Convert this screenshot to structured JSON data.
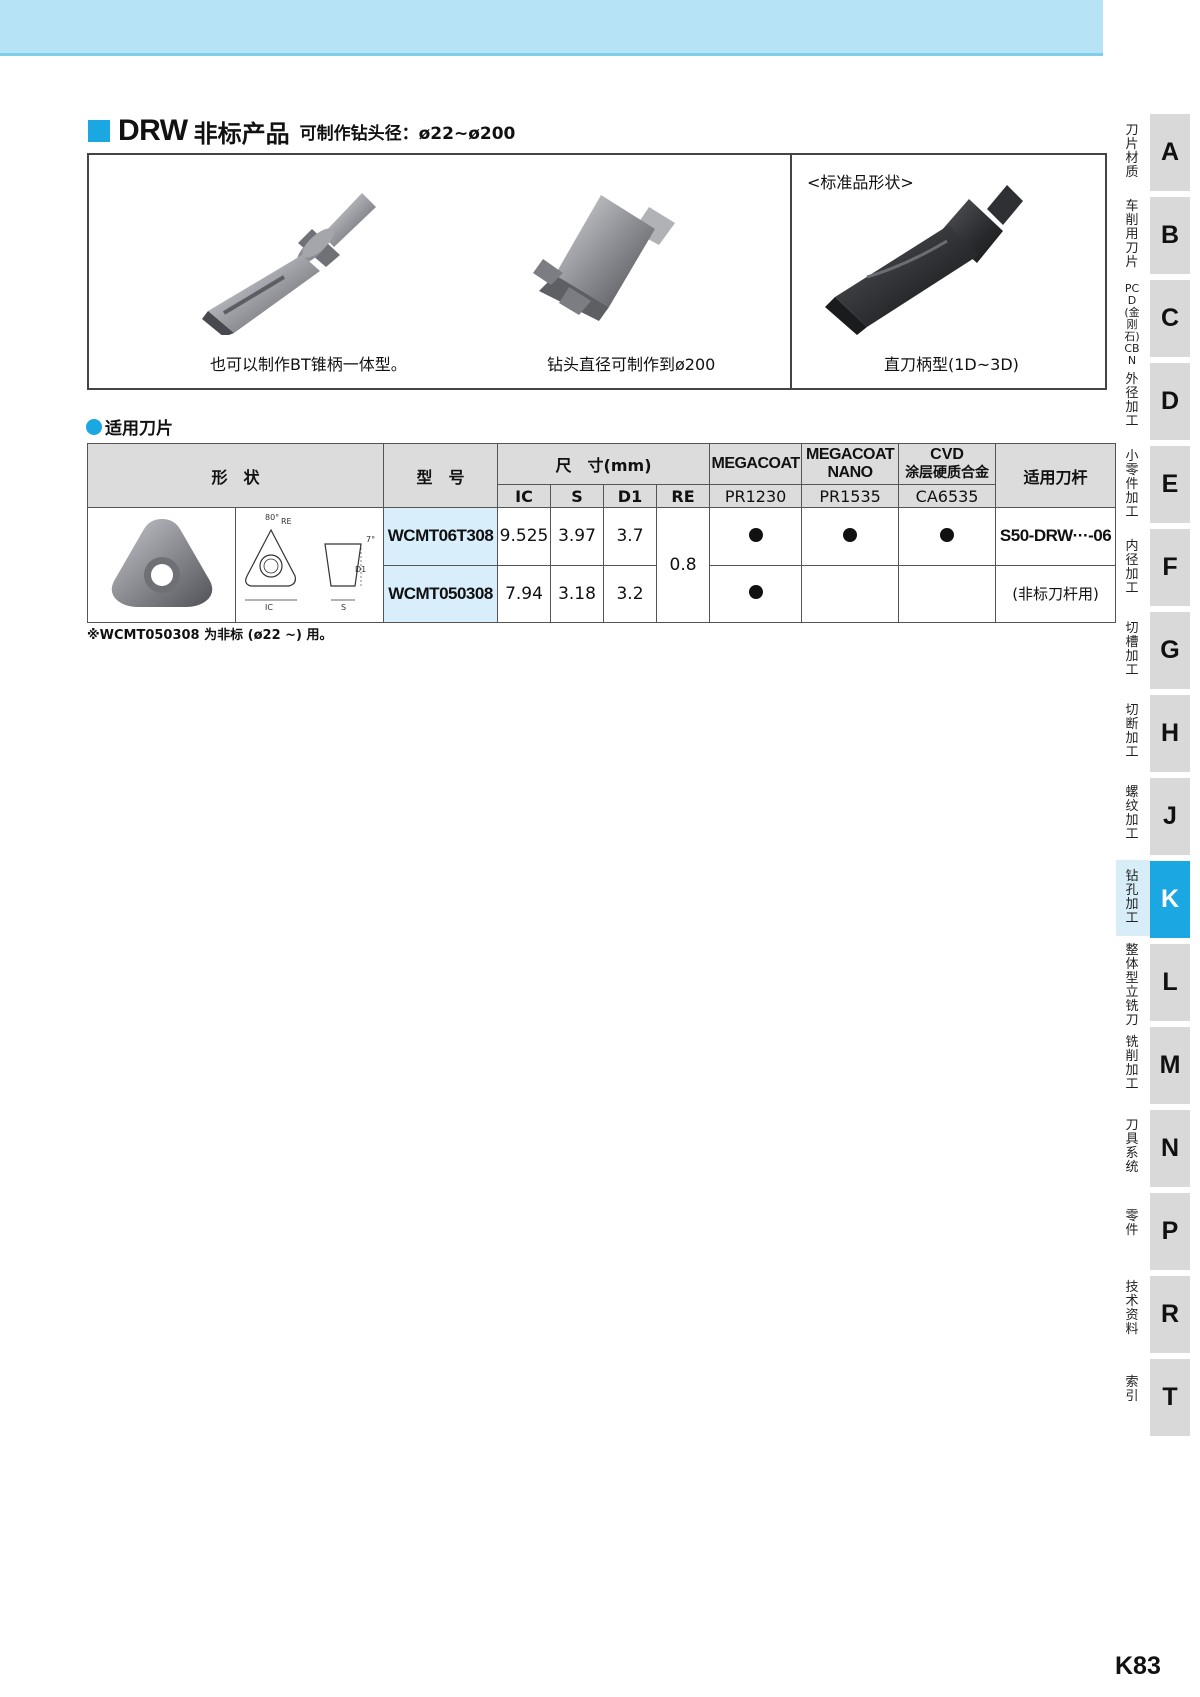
{
  "header": {
    "title_main": "DRW",
    "title_cn": "非标产品",
    "title_sub": "可制作钻头径：ø22~ø200"
  },
  "products": {
    "standard_label": "<标准品形状>",
    "captions": [
      "也可以制作BT锥柄一体型。",
      "钻头直径可制作到ø200",
      "直刀柄型(1D~3D)"
    ]
  },
  "inserts_section": {
    "heading": "适用刀片",
    "columns": {
      "shape": "形　状",
      "model": "型　号",
      "dimensions": "尺　寸(mm)",
      "ic": "IC",
      "s": "S",
      "d1": "D1",
      "re": "RE",
      "grade1_name": "MEGACOAT",
      "grade1_code": "PR1230",
      "grade2_name_line1": "MEGACOAT",
      "grade2_name_line2": "NANO",
      "grade2_code": "PR1535",
      "grade3_name_line1": "CVD",
      "grade3_name_line2": "涂层硬质合金",
      "grade3_code": "CA6535",
      "holder": "适用刀杆"
    },
    "diagram_labels": {
      "angle": "80°",
      "re": "RE",
      "seven": "7°",
      "d1": "D1",
      "ic": "IC",
      "s": "S"
    },
    "rows": [
      {
        "model": "WCMT06T308",
        "ic": "9.525",
        "s": "3.97",
        "d1": "3.7",
        "re": "0.8",
        "pr1230": true,
        "pr1535": true,
        "ca6535": true,
        "holder": "S50-DRW···-06"
      },
      {
        "model": "WCMT050308",
        "ic": "7.94",
        "s": "3.18",
        "d1": "3.2",
        "re": "0.8",
        "pr1230": true,
        "pr1535": false,
        "ca6535": false,
        "holder": "(非标刀杆用)"
      }
    ],
    "footnote": "※WCMT050308 为非标 (ø22 ~) 用。"
  },
  "side_tabs": [
    {
      "letter": "A",
      "label": "刀片材质"
    },
    {
      "letter": "B",
      "label": "车削用刀片"
    },
    {
      "letter": "C",
      "label": "PCD(金刚石) CBN"
    },
    {
      "letter": "D",
      "label": "外径加工"
    },
    {
      "letter": "E",
      "label": "小零件加工"
    },
    {
      "letter": "F",
      "label": "内径加工"
    },
    {
      "letter": "G",
      "label": "切槽加工"
    },
    {
      "letter": "H",
      "label": "切断加工"
    },
    {
      "letter": "J",
      "label": "螺纹加工"
    },
    {
      "letter": "K",
      "label": "钻孔加工",
      "active": true
    },
    {
      "letter": "L",
      "label": "整体型立铣刀"
    },
    {
      "letter": "M",
      "label": "铣削加工"
    },
    {
      "letter": "N",
      "label": "刀具系统"
    },
    {
      "letter": "P",
      "label": "零件"
    },
    {
      "letter": "R",
      "label": "技术资料"
    },
    {
      "letter": "T",
      "label": "索引"
    }
  ],
  "page_number": "K83",
  "colors": {
    "accent": "#1aa7e2",
    "band": "#b6e3f6",
    "table_head": "#dcdcdc",
    "model_cell": "#d8eefa",
    "tab": "#d9d9d9"
  }
}
